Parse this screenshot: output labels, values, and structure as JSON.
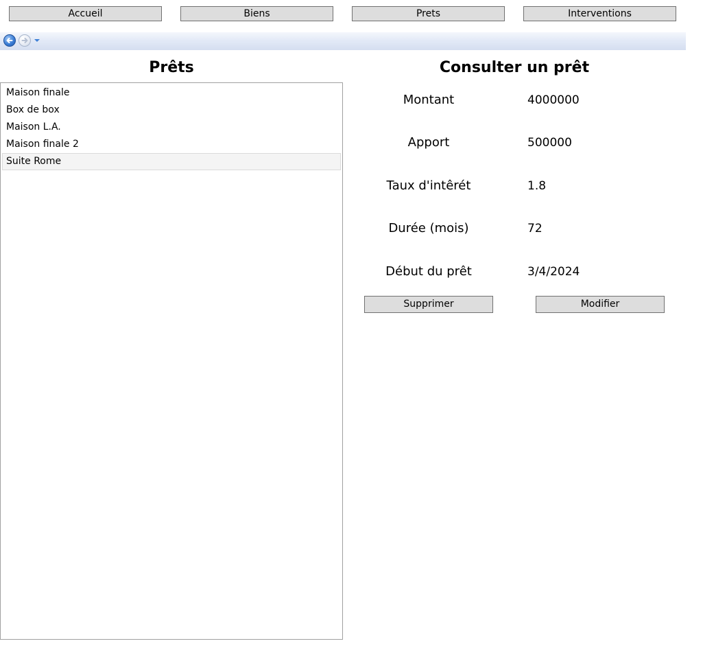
{
  "nav": {
    "home_label": "Accueil",
    "assets_label": "Biens",
    "loans_label": "Prets",
    "interventions_label": "Interventions"
  },
  "left_panel": {
    "title": "Prêts",
    "items": [
      {
        "label": "Maison finale"
      },
      {
        "label": "Box de box"
      },
      {
        "label": "Maison L.A."
      },
      {
        "label": "Maison finale 2"
      },
      {
        "label": "Suite Rome",
        "selected": true
      }
    ]
  },
  "right_panel": {
    "title": "Consulter un prêt",
    "fields": [
      {
        "label": "Montant",
        "value": "4000000"
      },
      {
        "label": "Apport",
        "value": "500000"
      },
      {
        "label": "Taux d'intêrét",
        "value": "1.8"
      },
      {
        "label": "Durée (mois)",
        "value": "72"
      },
      {
        "label": "Début du prêt",
        "value": "3/4/2024"
      }
    ],
    "delete_label": "Supprimer",
    "edit_label": "Modifier"
  },
  "colors": {
    "button_bg": "#dddddd",
    "button_border": "#707070",
    "selection_bg": "#f4f4f4",
    "nav_back_blue": "#3d7fd6"
  },
  "icons": {
    "back": "back-arrow-icon",
    "forward": "forward-arrow-icon",
    "history": "chevron-down-icon"
  }
}
